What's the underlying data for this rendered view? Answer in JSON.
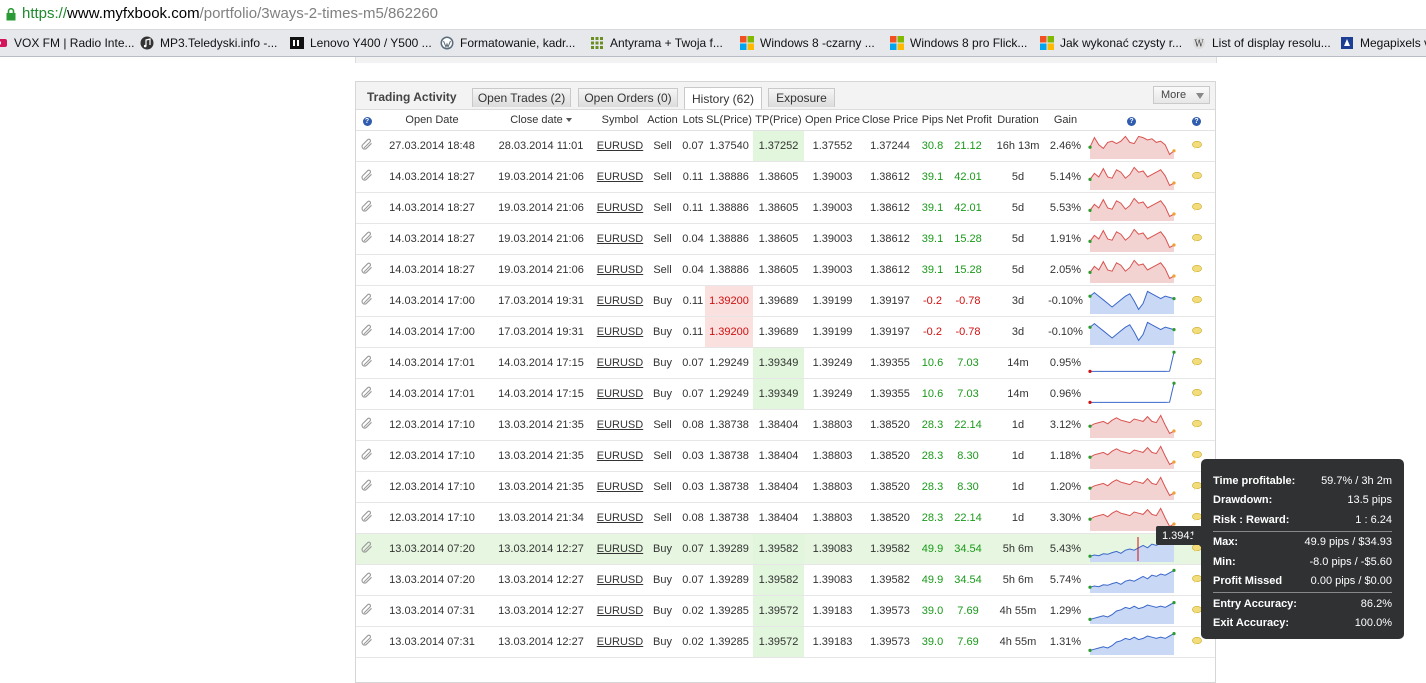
{
  "browser": {
    "url_scheme": "https://",
    "url_host": "www.myfxbook.com",
    "url_path": "/portfolio/3ways-2-times-m5/862260",
    "bookmarks": [
      {
        "label": "VOX FM | Radio Inte...",
        "icon": "radio-icon"
      },
      {
        "label": "MP3.Teledyski.info -...",
        "icon": "music-note-icon"
      },
      {
        "label": "Lenovo Y400 / Y500 ...",
        "icon": "tech-site-icon"
      },
      {
        "label": "Formatowanie, kadr...",
        "icon": "wordpress-icon"
      },
      {
        "label": "Antyrama + Twoja f...",
        "icon": "grid-icon"
      },
      {
        "label": "Windows 8 -czarny ...",
        "icon": "windows-icon"
      },
      {
        "label": "Windows 8 pro Flick...",
        "icon": "windows-icon"
      },
      {
        "label": "Jak wykonać czysty r...",
        "icon": "windows-icon"
      },
      {
        "label": "List of display resolu...",
        "icon": "wiki-icon"
      },
      {
        "label": "Megapixels v",
        "icon": "megapixels-icon"
      }
    ]
  },
  "panel": {
    "title": "Trading Activity",
    "tabs": [
      {
        "label": "Open Trades (2)",
        "active": false
      },
      {
        "label": "Open Orders (0)",
        "active": false
      },
      {
        "label": "History (62)",
        "active": true
      },
      {
        "label": "Exposure",
        "active": false
      }
    ],
    "more_label": "More",
    "columns": {
      "help": "?",
      "open_date": "Open Date",
      "close_date": "Close date",
      "symbol": "Symbol",
      "action": "Action",
      "lots": "Lots",
      "sl": "SL(Price)",
      "tp": "TP(Price)",
      "open_price": "Open Price",
      "close_price": "Close Price",
      "pips": "Pips",
      "net_profit": "Net Profit",
      "duration": "Duration",
      "gain": "Gain"
    },
    "rows": [
      {
        "open_date": "27.03.2014 18:48",
        "close_date": "28.03.2014 11:01",
        "symbol": "EURUSD",
        "action": "Sell",
        "lots": "0.07",
        "sl": "1.37540",
        "tp": "1.37252",
        "open_price": "1.37552",
        "close_price": "1.37244",
        "pips": "30.8",
        "net_profit": "21.12",
        "duration": "16h 13m",
        "gain": "2.46%",
        "sl_hit": false,
        "tp_hit": true,
        "highlight": false,
        "spark_type": "sell",
        "spark": [
          0.55,
          0.15,
          0.45,
          0.6,
          0.35,
          0.3,
          0.4,
          0.3,
          0.1,
          0.35,
          0.4,
          0.1,
          0.15,
          0.25,
          0.2,
          0.35,
          0.3,
          0.45,
          0.85,
          0.7
        ]
      },
      {
        "open_date": "14.03.2014 18:27",
        "close_date": "19.03.2014 21:06",
        "symbol": "EURUSD",
        "action": "Sell",
        "lots": "0.11",
        "sl": "1.38886",
        "tp": "1.38605",
        "open_price": "1.39003",
        "close_price": "1.38612",
        "pips": "39.1",
        "net_profit": "42.01",
        "duration": "5d",
        "gain": "5.14%",
        "sl_hit": false,
        "tp_hit": false,
        "highlight": false,
        "spark_type": "sell",
        "spark": [
          0.6,
          0.35,
          0.5,
          0.15,
          0.5,
          0.55,
          0.2,
          0.3,
          0.55,
          0.4,
          0.1,
          0.3,
          0.25,
          0.5,
          0.4,
          0.3,
          0.2,
          0.45,
          0.85,
          0.75
        ]
      },
      {
        "open_date": "14.03.2014 18:27",
        "close_date": "19.03.2014 21:06",
        "symbol": "EURUSD",
        "action": "Sell",
        "lots": "0.11",
        "sl": "1.38886",
        "tp": "1.38605",
        "open_price": "1.39003",
        "close_price": "1.38612",
        "pips": "39.1",
        "net_profit": "42.01",
        "duration": "5d",
        "gain": "5.53%",
        "sl_hit": false,
        "tp_hit": false,
        "highlight": false,
        "spark_type": "sell",
        "spark": [
          0.6,
          0.35,
          0.5,
          0.15,
          0.5,
          0.55,
          0.2,
          0.3,
          0.55,
          0.4,
          0.1,
          0.3,
          0.25,
          0.5,
          0.4,
          0.3,
          0.2,
          0.45,
          0.85,
          0.75
        ]
      },
      {
        "open_date": "14.03.2014 18:27",
        "close_date": "19.03.2014 21:06",
        "symbol": "EURUSD",
        "action": "Sell",
        "lots": "0.04",
        "sl": "1.38886",
        "tp": "1.38605",
        "open_price": "1.39003",
        "close_price": "1.38612",
        "pips": "39.1",
        "net_profit": "15.28",
        "duration": "5d",
        "gain": "1.91%",
        "sl_hit": false,
        "tp_hit": false,
        "highlight": false,
        "spark_type": "sell",
        "spark": [
          0.6,
          0.35,
          0.5,
          0.15,
          0.5,
          0.55,
          0.2,
          0.3,
          0.55,
          0.4,
          0.1,
          0.3,
          0.25,
          0.5,
          0.4,
          0.3,
          0.2,
          0.45,
          0.85,
          0.75
        ]
      },
      {
        "open_date": "14.03.2014 18:27",
        "close_date": "19.03.2014 21:06",
        "symbol": "EURUSD",
        "action": "Sell",
        "lots": "0.04",
        "sl": "1.38886",
        "tp": "1.38605",
        "open_price": "1.39003",
        "close_price": "1.38612",
        "pips": "39.1",
        "net_profit": "15.28",
        "duration": "5d",
        "gain": "2.05%",
        "sl_hit": false,
        "tp_hit": false,
        "highlight": false,
        "spark_type": "sell",
        "spark": [
          0.6,
          0.35,
          0.5,
          0.15,
          0.5,
          0.55,
          0.2,
          0.3,
          0.55,
          0.4,
          0.1,
          0.3,
          0.25,
          0.5,
          0.4,
          0.3,
          0.2,
          0.45,
          0.85,
          0.75
        ]
      },
      {
        "open_date": "14.03.2014 17:00",
        "close_date": "17.03.2014 19:31",
        "symbol": "EURUSD",
        "action": "Buy",
        "lots": "0.11",
        "sl": "1.39200",
        "tp": "1.39689",
        "open_price": "1.39199",
        "close_price": "1.39197",
        "pips": "-0.2",
        "net_profit": "-0.78",
        "duration": "3d",
        "gain": "-0.10%",
        "sl_hit": true,
        "tp_hit": false,
        "highlight": false,
        "spark_type": "buy",
        "spark": [
          0.3,
          0.15,
          0.3,
          0.45,
          0.6,
          0.75,
          0.6,
          0.45,
          0.3,
          0.2,
          0.5,
          0.85,
          0.6,
          0.1,
          0.2,
          0.3,
          0.4,
          0.3,
          0.35,
          0.4
        ]
      },
      {
        "open_date": "14.03.2014 17:00",
        "close_date": "17.03.2014 19:31",
        "symbol": "EURUSD",
        "action": "Buy",
        "lots": "0.11",
        "sl": "1.39200",
        "tp": "1.39689",
        "open_price": "1.39199",
        "close_price": "1.39197",
        "pips": "-0.2",
        "net_profit": "-0.78",
        "duration": "3d",
        "gain": "-0.10%",
        "sl_hit": true,
        "tp_hit": false,
        "highlight": false,
        "spark_type": "buy",
        "spark": [
          0.3,
          0.15,
          0.3,
          0.45,
          0.6,
          0.75,
          0.6,
          0.45,
          0.3,
          0.2,
          0.5,
          0.85,
          0.6,
          0.1,
          0.2,
          0.3,
          0.4,
          0.3,
          0.35,
          0.4
        ]
      },
      {
        "open_date": "14.03.2014 17:01",
        "close_date": "14.03.2014 17:15",
        "symbol": "EURUSD",
        "action": "Buy",
        "lots": "0.07",
        "sl": "1.29249",
        "tp": "1.39349",
        "open_price": "1.39249",
        "close_price": "1.39355",
        "pips": "10.6",
        "net_profit": "7.03",
        "duration": "14m",
        "gain": "0.95%",
        "sl_hit": false,
        "tp_hit": true,
        "highlight": false,
        "spark_type": "flat",
        "spark": [
          0.85,
          0.85,
          0.85,
          0.85,
          0.85,
          0.85,
          0.85,
          0.85,
          0.85,
          0.85,
          0.85,
          0.85,
          0.85,
          0.85,
          0.85,
          0.85,
          0.85,
          0.85,
          0.84,
          0.05
        ]
      },
      {
        "open_date": "14.03.2014 17:01",
        "close_date": "14.03.2014 17:15",
        "symbol": "EURUSD",
        "action": "Buy",
        "lots": "0.07",
        "sl": "1.29249",
        "tp": "1.39349",
        "open_price": "1.39249",
        "close_price": "1.39355",
        "pips": "10.6",
        "net_profit": "7.03",
        "duration": "14m",
        "gain": "0.96%",
        "sl_hit": false,
        "tp_hit": true,
        "highlight": false,
        "spark_type": "flat",
        "spark": [
          0.85,
          0.85,
          0.85,
          0.85,
          0.85,
          0.85,
          0.85,
          0.85,
          0.85,
          0.85,
          0.85,
          0.85,
          0.85,
          0.85,
          0.85,
          0.85,
          0.85,
          0.85,
          0.84,
          0.05
        ]
      },
      {
        "open_date": "12.03.2014 17:10",
        "close_date": "13.03.2014 21:35",
        "symbol": "EURUSD",
        "action": "Sell",
        "lots": "0.08",
        "sl": "1.38738",
        "tp": "1.38404",
        "open_price": "1.38803",
        "close_price": "1.38520",
        "pips": "28.3",
        "net_profit": "22.14",
        "duration": "1d",
        "gain": "3.12%",
        "sl_hit": false,
        "tp_hit": false,
        "highlight": false,
        "spark_type": "sell",
        "spark": [
          0.55,
          0.45,
          0.4,
          0.35,
          0.45,
          0.3,
          0.2,
          0.3,
          0.35,
          0.4,
          0.25,
          0.3,
          0.35,
          0.15,
          0.35,
          0.4,
          0.1,
          0.5,
          0.85,
          0.75
        ]
      },
      {
        "open_date": "12.03.2014 17:10",
        "close_date": "13.03.2014 21:35",
        "symbol": "EURUSD",
        "action": "Sell",
        "lots": "0.03",
        "sl": "1.38738",
        "tp": "1.38404",
        "open_price": "1.38803",
        "close_price": "1.38520",
        "pips": "28.3",
        "net_profit": "8.30",
        "duration": "1d",
        "gain": "1.18%",
        "sl_hit": false,
        "tp_hit": false,
        "highlight": false,
        "spark_type": "sell",
        "spark": [
          0.55,
          0.45,
          0.4,
          0.35,
          0.45,
          0.3,
          0.2,
          0.3,
          0.35,
          0.4,
          0.25,
          0.3,
          0.35,
          0.15,
          0.35,
          0.4,
          0.1,
          0.5,
          0.85,
          0.75
        ]
      },
      {
        "open_date": "12.03.2014 17:10",
        "close_date": "13.03.2014 21:35",
        "symbol": "EURUSD",
        "action": "Sell",
        "lots": "0.03",
        "sl": "1.38738",
        "tp": "1.38404",
        "open_price": "1.38803",
        "close_price": "1.38520",
        "pips": "28.3",
        "net_profit": "8.30",
        "duration": "1d",
        "gain": "1.20%",
        "sl_hit": false,
        "tp_hit": false,
        "highlight": false,
        "spark_type": "sell",
        "spark": [
          0.55,
          0.45,
          0.4,
          0.35,
          0.45,
          0.3,
          0.2,
          0.3,
          0.35,
          0.4,
          0.25,
          0.3,
          0.35,
          0.15,
          0.35,
          0.4,
          0.1,
          0.5,
          0.85,
          0.75
        ]
      },
      {
        "open_date": "12.03.2014 17:10",
        "close_date": "13.03.2014 21:34",
        "symbol": "EURUSD",
        "action": "Sell",
        "lots": "0.08",
        "sl": "1.38738",
        "tp": "1.38404",
        "open_price": "1.38803",
        "close_price": "1.38520",
        "pips": "28.3",
        "net_profit": "22.14",
        "duration": "1d",
        "gain": "3.30%",
        "sl_hit": false,
        "tp_hit": false,
        "highlight": false,
        "spark_type": "sell",
        "spark": [
          0.55,
          0.45,
          0.4,
          0.35,
          0.45,
          0.3,
          0.2,
          0.3,
          0.35,
          0.4,
          0.25,
          0.3,
          0.35,
          0.15,
          0.35,
          0.4,
          0.1,
          0.5,
          0.85,
          0.75
        ]
      },
      {
        "open_date": "13.03.2014 07:20",
        "close_date": "13.03.2014 12:27",
        "symbol": "EURUSD",
        "action": "Buy",
        "lots": "0.07",
        "sl": "1.39289",
        "tp": "1.39582",
        "open_price": "1.39083",
        "close_price": "1.39582",
        "pips": "49.9",
        "net_profit": "34.54",
        "duration": "5h 6m",
        "gain": "5.43%",
        "sl_hit": false,
        "tp_hit": true,
        "highlight": true,
        "spark_type": "buy",
        "spark": [
          0.8,
          0.75,
          0.78,
          0.7,
          0.72,
          0.65,
          0.6,
          0.68,
          0.55,
          0.5,
          0.55,
          0.45,
          0.35,
          0.45,
          0.3,
          0.35,
          0.25,
          0.3,
          0.2,
          0.1
        ]
      },
      {
        "open_date": "13.03.2014 07:20",
        "close_date": "13.03.2014 12:27",
        "symbol": "EURUSD",
        "action": "Buy",
        "lots": "0.07",
        "sl": "1.39289",
        "tp": "1.39582",
        "open_price": "1.39083",
        "close_price": "1.39582",
        "pips": "49.9",
        "net_profit": "34.54",
        "duration": "5h 6m",
        "gain": "5.74%",
        "sl_hit": false,
        "tp_hit": true,
        "highlight": false,
        "spark_type": "buy",
        "spark": [
          0.8,
          0.75,
          0.78,
          0.7,
          0.72,
          0.65,
          0.6,
          0.68,
          0.55,
          0.5,
          0.55,
          0.45,
          0.35,
          0.45,
          0.3,
          0.35,
          0.25,
          0.3,
          0.2,
          0.1
        ]
      },
      {
        "open_date": "13.03.2014 07:31",
        "close_date": "13.03.2014 12:27",
        "symbol": "EURUSD",
        "action": "Buy",
        "lots": "0.02",
        "sl": "1.39285",
        "tp": "1.39572",
        "open_price": "1.39183",
        "close_price": "1.39573",
        "pips": "39.0",
        "net_profit": "7.69",
        "duration": "4h 55m",
        "gain": "1.29%",
        "sl_hit": false,
        "tp_hit": true,
        "highlight": false,
        "spark_type": "buy",
        "spark": [
          0.85,
          0.8,
          0.75,
          0.7,
          0.75,
          0.65,
          0.5,
          0.45,
          0.35,
          0.4,
          0.3,
          0.4,
          0.35,
          0.25,
          0.3,
          0.35,
          0.3,
          0.35,
          0.25,
          0.15
        ]
      },
      {
        "open_date": "13.03.2014 07:31",
        "close_date": "13.03.2014 12:27",
        "symbol": "EURUSD",
        "action": "Buy",
        "lots": "0.02",
        "sl": "1.39285",
        "tp": "1.39572",
        "open_price": "1.39183",
        "close_price": "1.39573",
        "pips": "39.0",
        "net_profit": "7.69",
        "duration": "4h 55m",
        "gain": "1.31%",
        "sl_hit": false,
        "tp_hit": true,
        "highlight": false,
        "spark_type": "buy",
        "spark": [
          0.85,
          0.8,
          0.75,
          0.7,
          0.75,
          0.65,
          0.5,
          0.45,
          0.35,
          0.4,
          0.3,
          0.4,
          0.35,
          0.25,
          0.3,
          0.35,
          0.3,
          0.35,
          0.25,
          0.15
        ]
      }
    ]
  },
  "hover_label": "1.3941",
  "tooltip": {
    "rows1": [
      {
        "k": "Time profitable:",
        "v": "59.7% / 3h 2m"
      },
      {
        "k": "Drawdown:",
        "v": "13.5 pips"
      },
      {
        "k": "Risk : Reward:",
        "v": "1 : 6.24"
      }
    ],
    "rows2": [
      {
        "k": "Max:",
        "v": "49.9 pips / $34.93"
      },
      {
        "k": "Min:",
        "v": "-8.0 pips / -$5.60"
      },
      {
        "k": "Profit Missed",
        "v": "0.00 pips / $0.00"
      }
    ],
    "rows3": [
      {
        "k": "Entry Accuracy:",
        "v": "86.2%"
      },
      {
        "k": "Exit Accuracy:",
        "v": "100.0%"
      }
    ]
  },
  "colors": {
    "sell_fill": "#f3d2d2",
    "sell_line": "#d9534f",
    "buy_fill": "#c9d8f5",
    "buy_line": "#3a67c9",
    "positive": "#1a9a1a",
    "negative": "#d01010"
  }
}
